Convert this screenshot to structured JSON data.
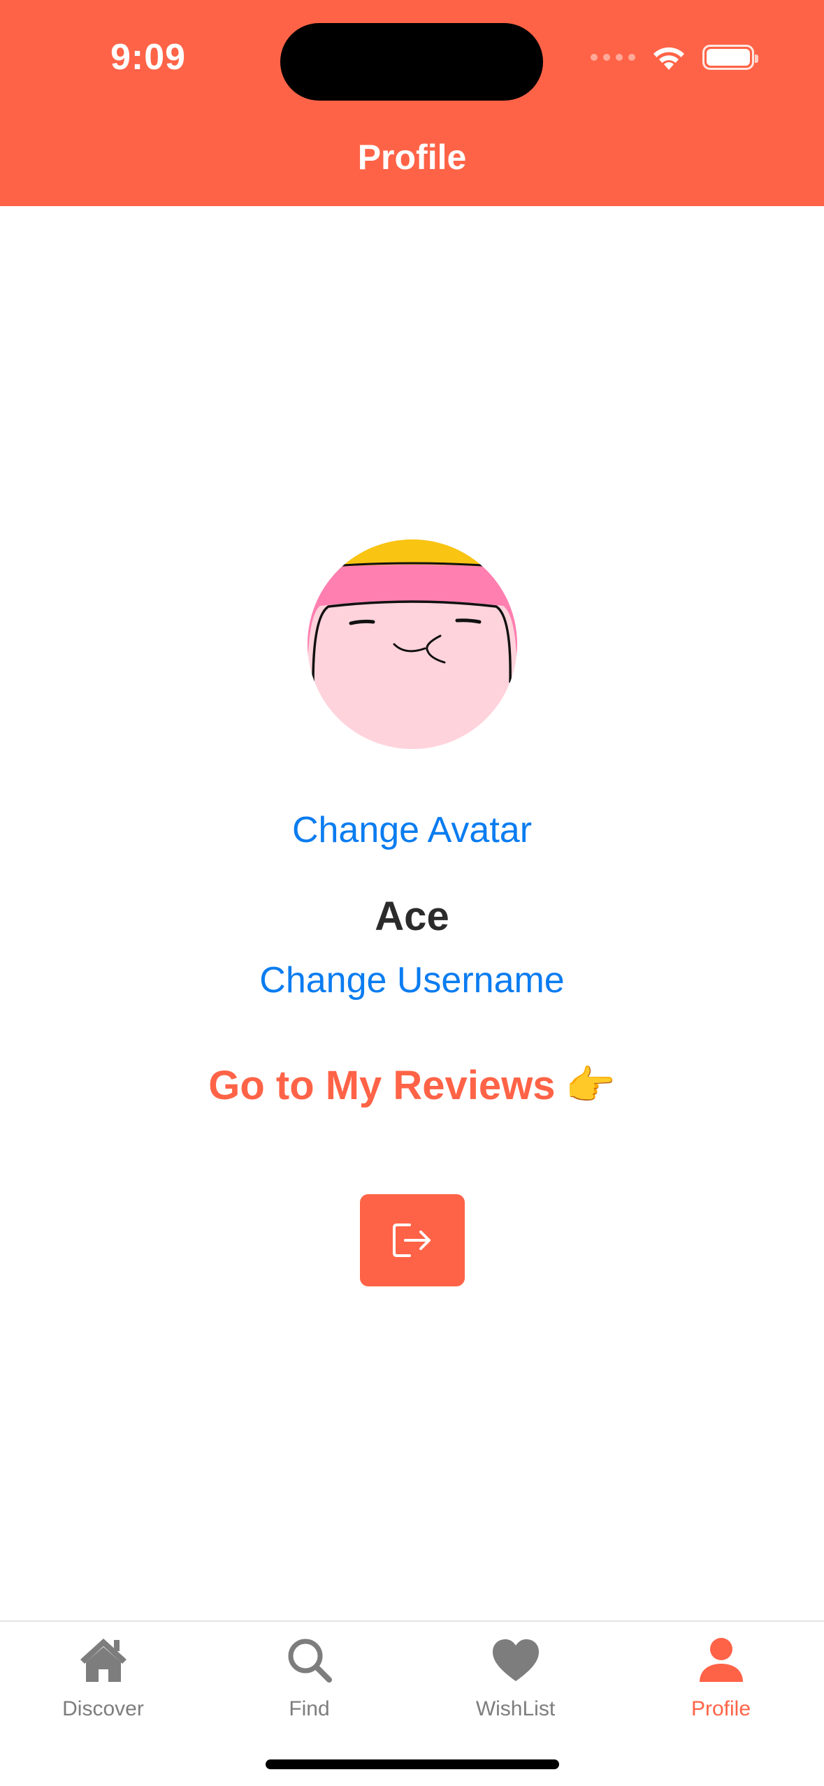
{
  "status_bar": {
    "time": "9:09",
    "icons": [
      "cellular-icon",
      "wifi-icon",
      "battery-icon"
    ]
  },
  "nav": {
    "title": "Profile"
  },
  "profile": {
    "avatar_icon": "cartoon-avatar-icon",
    "change_avatar_label": "Change Avatar",
    "username": "Ace",
    "change_username_label": "Change Username",
    "reviews_link_label": "Go to My Reviews",
    "reviews_link_emoji": "👉",
    "logout_icon": "logout-icon"
  },
  "tab_bar": {
    "items": [
      {
        "label": "Discover",
        "icon": "house-icon",
        "active": false
      },
      {
        "label": "Find",
        "icon": "magnifying-glass-icon",
        "active": false
      },
      {
        "label": "WishList",
        "icon": "heart-icon",
        "active": false
      },
      {
        "label": "Profile",
        "icon": "person-icon",
        "active": true
      }
    ]
  },
  "colors": {
    "accent": "#ff6347",
    "link": "#0a7cf0",
    "tab_inactive": "#7d7d7d",
    "text_primary": "#2b2b2b"
  }
}
